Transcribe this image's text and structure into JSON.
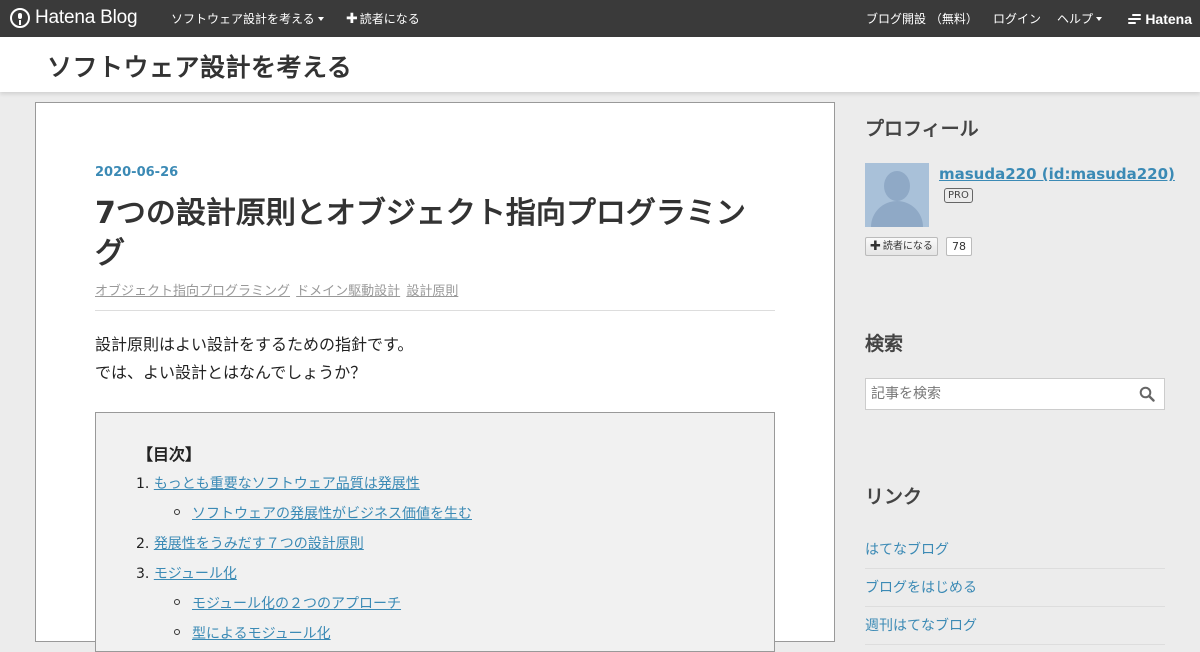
{
  "topbar": {
    "brand": "Hatena Blog",
    "blog_menu": "ソフトウェア設計を考える",
    "subscribe": "読者になる",
    "open_blog": "ブログ開設 （無料）",
    "login": "ログイン",
    "help": "ヘルプ",
    "hatena": "Hatena"
  },
  "header": {
    "blog_title": "ソフトウェア設計を考える"
  },
  "article": {
    "date": "2020-06-26",
    "title": "7つの設計原則とオブジェクト指向プログラミング",
    "categories": [
      "オブジェクト指向プログラミング",
      "ドメイン駆動設計",
      "設計原則"
    ],
    "lead_lines": [
      "設計原則はよい設計をするための指針です。",
      "では、よい設計とはなんでしょうか？"
    ],
    "toc": {
      "title": "【目次】",
      "items": [
        {
          "num": "1.",
          "text": "もっとも重要なソフトウェア品質は発展性"
        },
        {
          "sub": "ソフトウェアの発展性がビジネス価値を生む"
        },
        {
          "num": "2.",
          "text": "発展性をうみだす７つの設計原則"
        },
        {
          "num": "3.",
          "text": "モジュール化"
        },
        {
          "sub": "モジュール化の２つのアプローチ"
        },
        {
          "sub": "型によるモジュール化"
        }
      ]
    }
  },
  "sidebar": {
    "profile": {
      "heading": "プロフィール",
      "name": "masuda220 (id:masuda220)",
      "badge": "PRO",
      "subscribe_label": "読者になる",
      "subscriber_count": "78"
    },
    "search": {
      "heading": "検索",
      "placeholder": "記事を検索"
    },
    "links": {
      "heading": "リンク",
      "items": [
        "はてなブログ",
        "ブログをはじめる",
        "週刊はてなブログ"
      ]
    }
  }
}
